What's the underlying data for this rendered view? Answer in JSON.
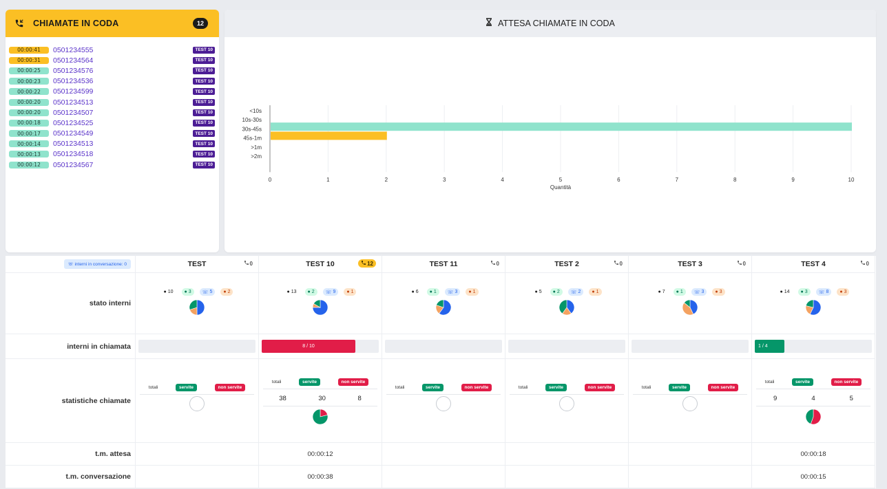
{
  "queue": {
    "title": "CHIAMATE IN CODA",
    "count": "12",
    "rows": [
      {
        "time": "00:00:41",
        "number": "0501234555",
        "tag": "TEST 10",
        "color": "yellow"
      },
      {
        "time": "00:00:31",
        "number": "0501234564",
        "tag": "TEST 10",
        "color": "yellow"
      },
      {
        "time": "00:00:25",
        "number": "0501234576",
        "tag": "TEST 10",
        "color": "green"
      },
      {
        "time": "00:00:23",
        "number": "0501234536",
        "tag": "TEST 10",
        "color": "green"
      },
      {
        "time": "00:00:22",
        "number": "0501234599",
        "tag": "TEST 10",
        "color": "green"
      },
      {
        "time": "00:00:20",
        "number": "0501234513",
        "tag": "TEST 10",
        "color": "green"
      },
      {
        "time": "00:00:20",
        "number": "0501234507",
        "tag": "TEST 10",
        "color": "green"
      },
      {
        "time": "00:00:18",
        "number": "0501234525",
        "tag": "TEST 10",
        "color": "green"
      },
      {
        "time": "00:00:17",
        "number": "0501234549",
        "tag": "TEST 10",
        "color": "green"
      },
      {
        "time": "00:00:14",
        "number": "0501234513",
        "tag": "TEST 10",
        "color": "green"
      },
      {
        "time": "00:00:13",
        "number": "0501234518",
        "tag": "TEST 10",
        "color": "green"
      },
      {
        "time": "00:00:12",
        "number": "0501234567",
        "tag": "TEST 10",
        "color": "green"
      }
    ]
  },
  "wait_chart": {
    "title": "ATTESA CHIAMATE IN CODA"
  },
  "chart_data": {
    "type": "bar",
    "orientation": "horizontal",
    "categories": [
      "<10s",
      "10s-30s",
      "30s-45s",
      "45s-1m",
      ">1m",
      ">2m"
    ],
    "values": [
      0,
      10,
      2,
      0,
      0,
      0
    ],
    "bar_colors": [
      "#8fe3cc",
      "#8fe3cc",
      "#fbbf24",
      "#fbbf24",
      "#fbbf24",
      "#fbbf24"
    ],
    "xlabel": "Quantità",
    "xlim": [
      0,
      10
    ],
    "xticks": [
      "0",
      "1",
      "2",
      "3",
      "4",
      "5",
      "6",
      "7",
      "8",
      "9",
      "10"
    ],
    "grid": true
  },
  "table": {
    "conv_badge": "interni in conversazione: 0",
    "row_labels": {
      "stato": "stato interni",
      "chiamata": "interni in chiamata",
      "statistiche": "statistiche chiamate",
      "attesa": "t.m. attesa",
      "conversazione": "t.m. conversazione"
    },
    "stat_labels": {
      "totali": "totali",
      "servite": "servite",
      "non_servite": "non servite"
    },
    "colors": {
      "green": "#059669",
      "red": "#e11d48",
      "blue": "#2563eb",
      "orange": "#f4a261",
      "yellow": "#fbbf24"
    },
    "queues": [
      {
        "name": "TEST",
        "calls": "0",
        "calls_highlight": false,
        "stato": {
          "total": "10",
          "green": "3",
          "blue": "5",
          "orange": "2"
        },
        "pie": {
          "blue": 5,
          "orange": 2,
          "green": 3
        },
        "in_call": {
          "text": "",
          "fraction": 0,
          "color": "none"
        },
        "stats": {
          "totali": "",
          "servite": "",
          "non_servite": ""
        },
        "stats_pie": null,
        "tm_attesa": "",
        "tm_conversazione": ""
      },
      {
        "name": "TEST 10",
        "calls": "12",
        "calls_highlight": true,
        "stato": {
          "total": "13",
          "green": "2",
          "blue": "9",
          "orange": "1"
        },
        "pie": {
          "blue": 9,
          "orange": 1,
          "green": 2
        },
        "in_call": {
          "text": "8 / 10",
          "fraction": 0.8,
          "color": "red"
        },
        "stats": {
          "totali": "38",
          "servite": "30",
          "non_servite": "8"
        },
        "stats_pie": {
          "servite": 30,
          "non_servite": 8
        },
        "tm_attesa": "00:00:12",
        "tm_conversazione": "00:00:38"
      },
      {
        "name": "TEST 11",
        "calls": "0",
        "calls_highlight": false,
        "stato": {
          "total": "6",
          "green": "1",
          "blue": "3",
          "orange": "1"
        },
        "pie": {
          "blue": 3,
          "orange": 1,
          "green": 1
        },
        "in_call": {
          "text": "",
          "fraction": 0,
          "color": "none"
        },
        "stats": {
          "totali": "",
          "servite": "",
          "non_servite": ""
        },
        "stats_pie": null,
        "tm_attesa": "",
        "tm_conversazione": ""
      },
      {
        "name": "TEST 2",
        "calls": "0",
        "calls_highlight": false,
        "stato": {
          "total": "5",
          "green": "2",
          "blue": "2",
          "orange": "1"
        },
        "pie": {
          "blue": 2,
          "orange": 1,
          "green": 2
        },
        "in_call": {
          "text": "",
          "fraction": 0,
          "color": "none"
        },
        "stats": {
          "totali": "",
          "servite": "",
          "non_servite": ""
        },
        "stats_pie": null,
        "tm_attesa": "",
        "tm_conversazione": ""
      },
      {
        "name": "TEST 3",
        "calls": "0",
        "calls_highlight": false,
        "stato": {
          "total": "7",
          "green": "1",
          "blue": "3",
          "orange": "3"
        },
        "pie": {
          "blue": 3,
          "orange": 3,
          "green": 1
        },
        "in_call": {
          "text": "",
          "fraction": 0,
          "color": "none"
        },
        "stats": {
          "totali": "",
          "servite": "",
          "non_servite": ""
        },
        "stats_pie": null,
        "tm_attesa": "",
        "tm_conversazione": ""
      },
      {
        "name": "TEST 4",
        "calls": "0",
        "calls_highlight": false,
        "stato": {
          "total": "14",
          "green": "3",
          "blue": "8",
          "orange": "3"
        },
        "pie": {
          "blue": 8,
          "orange": 3,
          "green": 3
        },
        "in_call": {
          "text": "1 / 4",
          "fraction": 0.25,
          "color": "green"
        },
        "stats": {
          "totali": "9",
          "servite": "4",
          "non_servite": "5"
        },
        "stats_pie": {
          "servite": 4,
          "non_servite": 5
        },
        "tm_attesa": "00:00:18",
        "tm_conversazione": "00:00:15"
      }
    ]
  }
}
